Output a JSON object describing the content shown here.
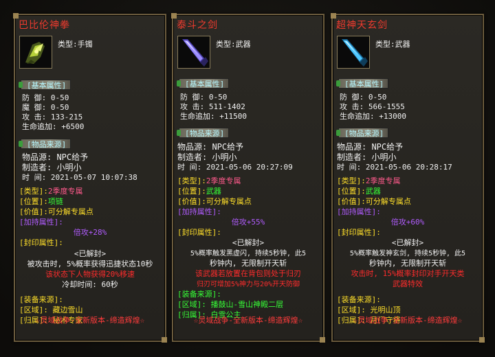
{
  "cards": [
    {
      "name": "巴比伦神拳",
      "type_line": "类型:手镯",
      "icon": "bracelet-icon",
      "basic_header": "[基本属性]",
      "stats": [
        "防   御: 0-50",
        "魔   御: 0-50",
        "攻   击: 133-215",
        "生命追加: +6500"
      ],
      "source_header": "[物品来源]",
      "source": [
        "物品源: NPC给予",
        "制造者: 小明小",
        "时  间: 2021-05-07 10:07:38"
      ],
      "info_type_label": "[类型]:",
      "info_type_value": "2季度专属",
      "info_pos_label": "[位置]:",
      "info_pos_value": "项链",
      "info_price_label": "[价值]:",
      "info_price_value": "可分解专属点",
      "bonus_label": "[加持属性]:",
      "bonus_value": "倍攻+28%",
      "seal_label": "[封印属性]:",
      "seal_state": "<已解封>",
      "seal_desc_1": "被攻击时, 5%概率获得迅捷状态10秒",
      "seal_desc_2": "该状态下人物获得20%移速",
      "seal_desc_3": "冷却时间: 60秒",
      "equip_label": "[装备来源]:",
      "region_label": "[区域]:",
      "region_value": "藏边雪山",
      "owner_label": "[归属]:",
      "owner_value": "秘术专家",
      "footer": "☆灵域战争-全新版本-缔造辉煌☆"
    },
    {
      "name": "泰斗之剑",
      "type_line": "类型:武器",
      "icon": "sword-icon",
      "basic_header": "[基本属性]",
      "stats": [
        "防   御: 0-50",
        "攻   击: 511-1402",
        "生命追加: +11500"
      ],
      "source_header": "[物品来源]",
      "source": [
        "物品源: NPC给予",
        "制造者: 小明小",
        "时  间: 2021-05-06 20:27:09"
      ],
      "info_type_label": "[类型]:",
      "info_type_value": "2季度专属",
      "info_pos_label": "[位置]:",
      "info_pos_value": "武器",
      "info_price_label": "[价值]:",
      "info_price_value": "可分解专属点",
      "bonus_label": "[加持属性]:",
      "bonus_value": "倍攻+55%",
      "seal_label": "[封印属性]:",
      "seal_state": "<已解封>",
      "seal_desc_1": "5%概率触发黑虚闪, 持续5秒钟, 此5",
      "seal_desc_2": "秒钟内, 无限制开天斩",
      "seal_desc_3": "该武器若放置在背包则处于归刃",
      "seal_desc_4": "归刃可增加5%神力与20%开天防御",
      "equip_label": "[装备来源]:",
      "region_label": "[区域]:",
      "region_value": "播鼓山-雪山神殿二层",
      "owner_label": "[归属]:",
      "owner_value": "白雪公主",
      "footer": "☆灵域战争-全新版本-缔造辉煌☆"
    },
    {
      "name": "超神天玄剑",
      "type_line": "类型:武器",
      "icon": "sword-icon",
      "basic_header": "[基本属性]",
      "stats": [
        "防   御: 0-50",
        "攻   击: 566-1555",
        "生命追加: +13000"
      ],
      "source_header": "[物品来源]",
      "source": [
        "物品源: NPC给予",
        "制造者: 小明小",
        "时  间: 2021-05-06 20:28:17"
      ],
      "info_type_label": "[类型]:",
      "info_type_value": "2季度专属",
      "info_pos_label": "[位置]:",
      "info_pos_value": "武器",
      "info_price_label": "[价值]:",
      "info_price_value": "可分解专属点",
      "bonus_label": "[加持属性]:",
      "bonus_value": "倍攻+60%",
      "seal_label": "[封印属性]:",
      "seal_state": "<已解封>",
      "seal_desc_1": "5%概率触发神玄剑, 持续5秒钟, 此5",
      "seal_desc_2": "秒钟内, 无限制开天斩",
      "seal_desc_3": "攻击时, 15%概率封印对手开天类",
      "seal_desc_4": "武器特效",
      "equip_label": "[装备来源]:",
      "region_label": "[区域]:",
      "region_value": "光明山顶",
      "owner_label": "[归属]:",
      "owner_value": "月门守将",
      "footer": "☆灵域战争-全新版本-缔造辉煌☆"
    }
  ]
}
